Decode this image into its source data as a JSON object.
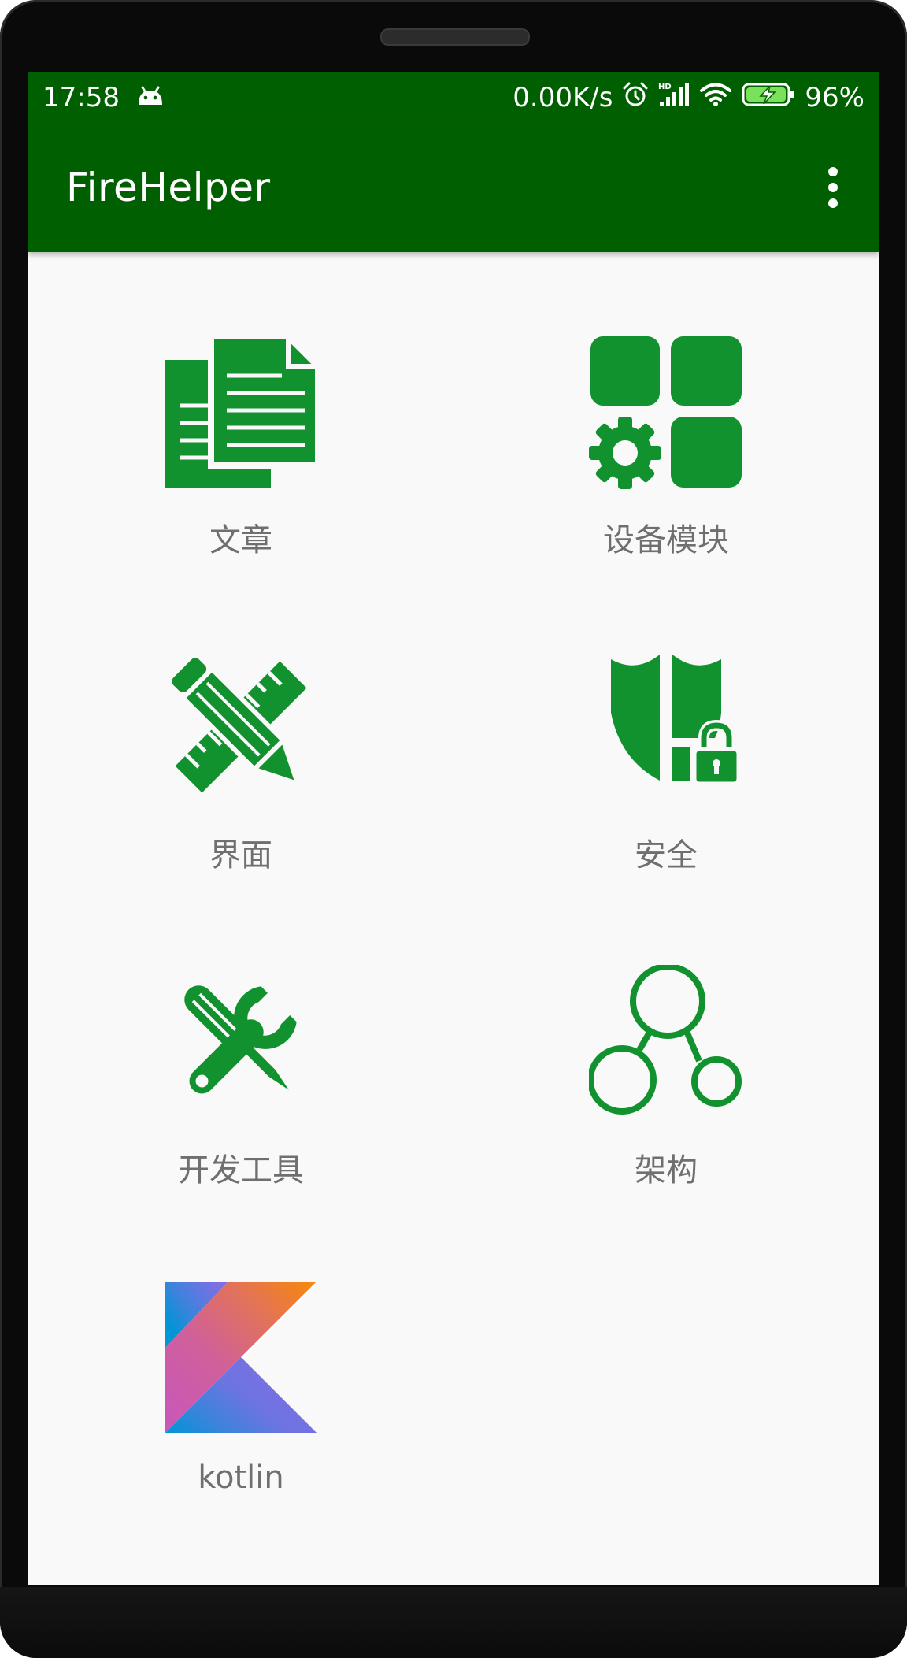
{
  "status_bar": {
    "time": "17:58",
    "notification_icon": "android-icon",
    "net_speed": "0.00K/s",
    "icons": [
      "alarm-icon",
      "hd-signal-icon",
      "wifi-icon",
      "battery-charging-icon"
    ],
    "battery_percent": "96%"
  },
  "app_bar": {
    "title": "FireHelper",
    "menu_icon": "overflow-menu-icon"
  },
  "colors": {
    "primary": "#005f00",
    "icon_green": "#12912f",
    "label_gray": "#6f6f6f",
    "background": "#f9f9f9"
  },
  "grid": {
    "items": [
      {
        "label": "文章",
        "icon": "documents-icon"
      },
      {
        "label": "设备模块",
        "icon": "modules-icon"
      },
      {
        "label": "界面",
        "icon": "ruler-pencil-icon"
      },
      {
        "label": "安全",
        "icon": "shield-lock-icon"
      },
      {
        "label": "开发工具",
        "icon": "wrench-screwdriver-icon"
      },
      {
        "label": "架构",
        "icon": "architecture-icon"
      },
      {
        "label": "kotlin",
        "icon": "kotlin-logo-icon"
      }
    ]
  }
}
